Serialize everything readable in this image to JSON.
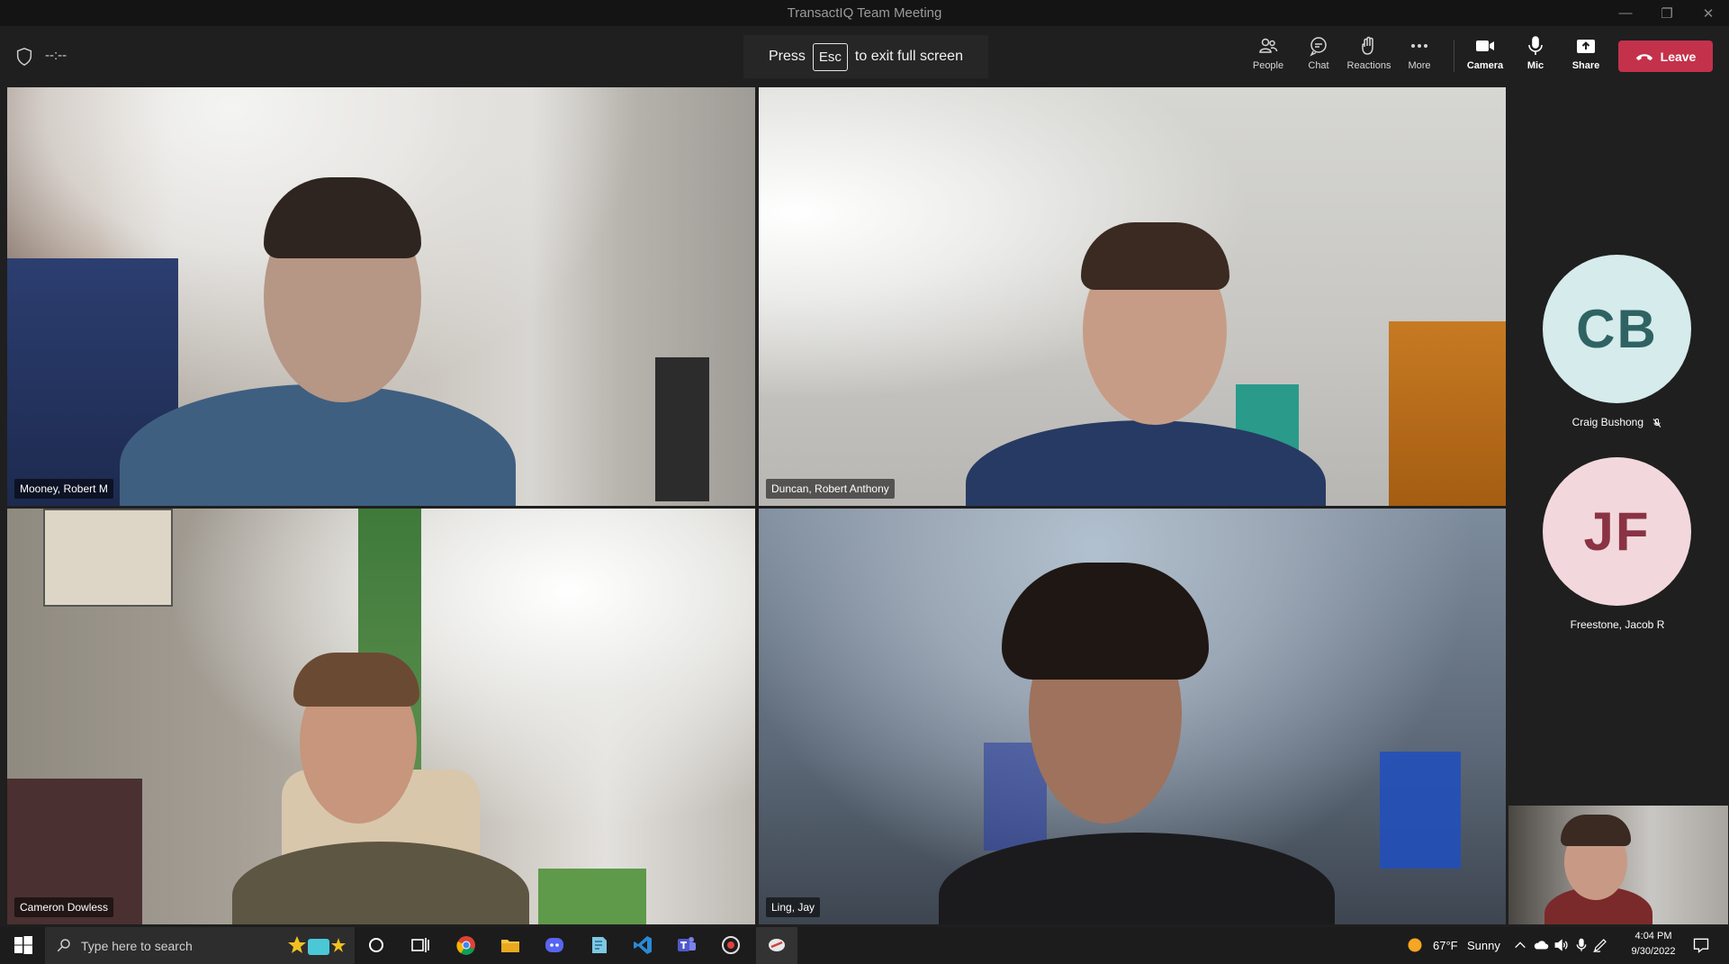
{
  "window": {
    "title": "TransactIQ Team Meeting"
  },
  "toolbar": {
    "timer": "--:--",
    "esc_press": "Press",
    "esc_key": "Esc",
    "esc_rest": "to exit full screen",
    "people": "People",
    "chat": "Chat",
    "reactions": "Reactions",
    "more": "More",
    "camera": "Camera",
    "mic": "Mic",
    "share": "Share",
    "leave": "Leave"
  },
  "participants": {
    "tile1": "Mooney, Robert M",
    "tile2": "Duncan, Robert Anthony",
    "tile3": "Cameron Dowless",
    "tile4": "Ling, Jay"
  },
  "side_participants": [
    {
      "initials": "CB",
      "name": "Craig Bushong",
      "muted": true,
      "bg": "#d6ebeb",
      "fg": "#2f6363"
    },
    {
      "initials": "JF",
      "name": "Freestone, Jacob R",
      "muted": false,
      "bg": "#f2d8dc",
      "fg": "#8a3344"
    }
  ],
  "taskbar": {
    "search_placeholder": "Type here to search",
    "weather_temp": "67°F",
    "weather_desc": "Sunny",
    "time": "4:04 PM",
    "date": "9/30/2022"
  }
}
